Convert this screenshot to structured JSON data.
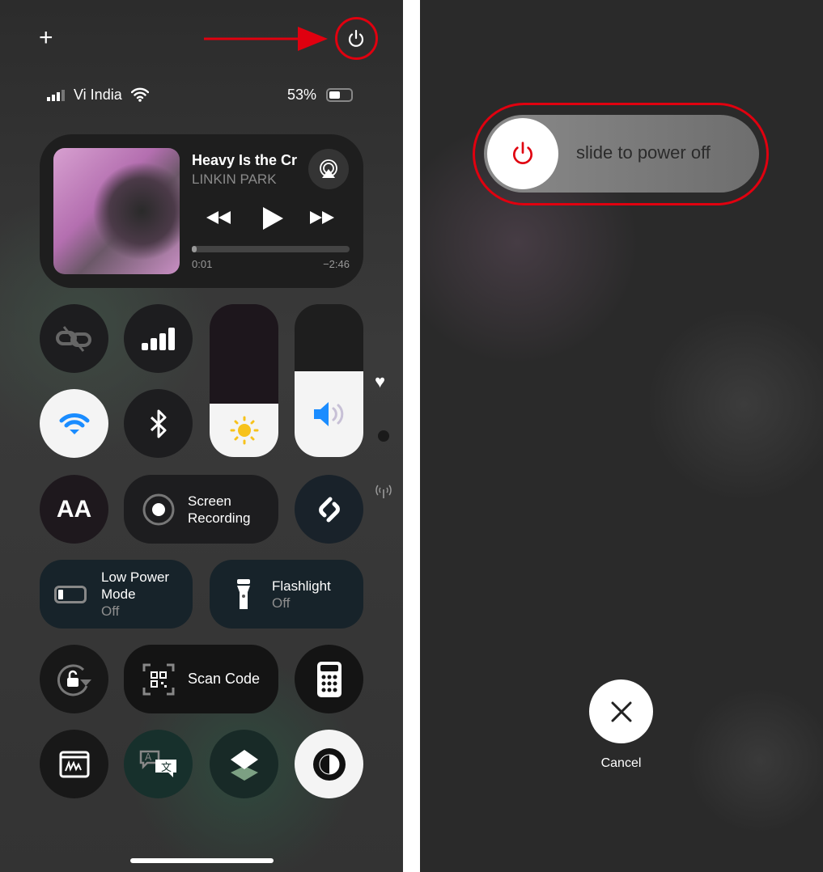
{
  "left": {
    "add_icon": "+",
    "status": {
      "carrier": "Vi India",
      "battery": "53%",
      "battery_level": 0.53
    },
    "media": {
      "title": "Heavy Is the Cr",
      "artist": "LINKIN PARK",
      "elapsed": "0:01",
      "remaining": "−2:46",
      "progress": 0.006
    },
    "brightness_level": 0.35,
    "volume_level": 0.56,
    "screen_recording": {
      "line1": "Screen",
      "line2": "Recording"
    },
    "text_size": "AA",
    "low_power": {
      "line1": "Low Power",
      "line2": "Mode",
      "state": "Off"
    },
    "flashlight": {
      "label": "Flashlight",
      "state": "Off"
    },
    "scan_code": "Scan Code",
    "accent_wifi": "#1a8cff",
    "accent_annotation": "#e0000f"
  },
  "right": {
    "slide_text": "slide to power off",
    "cancel": "Cancel",
    "power_color": "#e0000f"
  }
}
